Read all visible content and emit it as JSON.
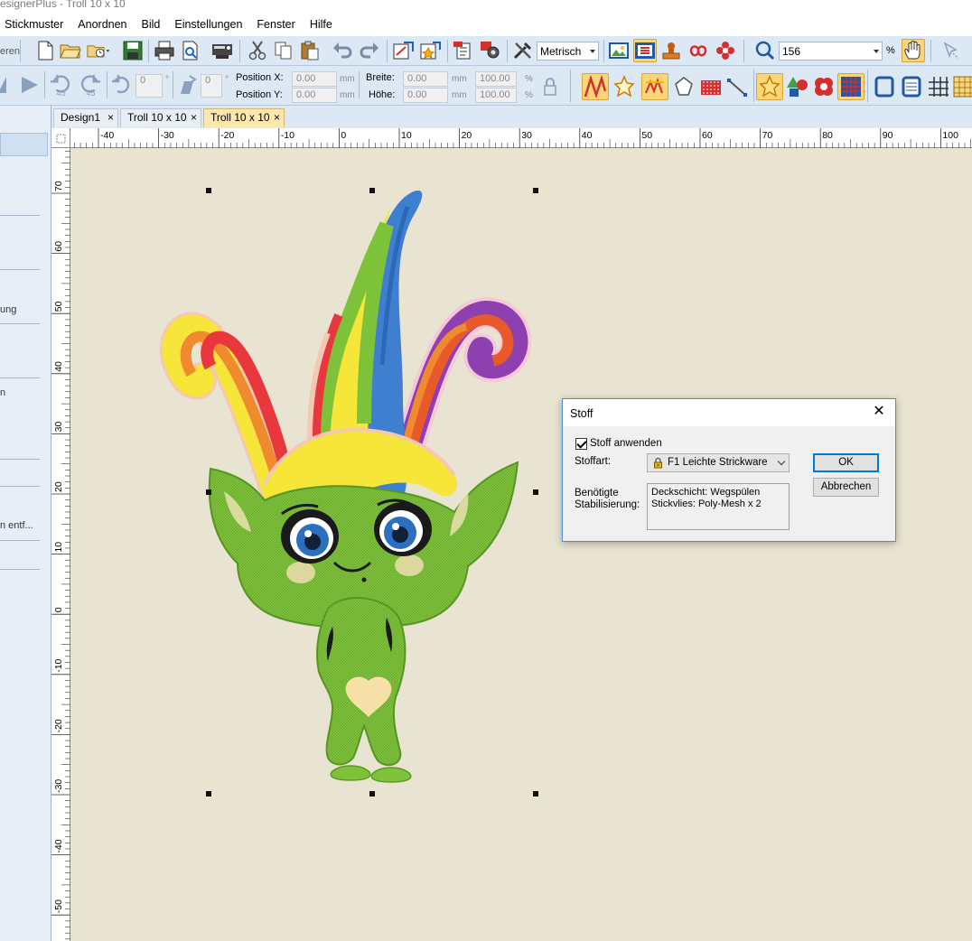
{
  "window": {
    "title": "esignerPlus - Troll 10 x 10"
  },
  "menu": [
    "Stickmuster",
    "Anordnen",
    "Bild",
    "Einstellungen",
    "Fenster",
    "Hilfe"
  ],
  "toolbar1": {
    "left_cut_text": "eren",
    "units_combo": "Metrisch",
    "zoom_value": "156",
    "zoom_unit": "%"
  },
  "toolbar2": {
    "rotate_value": "0",
    "rotate_unit": "°",
    "skew_value": "0",
    "skew_unit": "°",
    "position_x_label": "Position X:",
    "position_y_label": "Position Y:",
    "position_x_value": "0.00",
    "position_y_value": "0.00",
    "width_label": "Breite:",
    "height_label": "Höhe:",
    "width_value": "0.00",
    "height_value": "0.00",
    "unit_mm": "mm",
    "width_pct": "100.00",
    "height_pct": "100.00",
    "pct": "%",
    "rotate_45_left": "45",
    "rotate_45_right": "45"
  },
  "tabs": [
    {
      "label": "Design1",
      "close": "×",
      "active": false
    },
    {
      "label": "Troll 10 x 10",
      "close": "×",
      "active": false
    },
    {
      "label": "Troll 10 x 10",
      "close": "×",
      "active": true
    }
  ],
  "left_panel": {
    "items": [
      "ung",
      "n",
      "n entf..."
    ]
  },
  "ruler_h_labels": [
    "-40",
    "-30",
    "-20",
    "-10",
    "0",
    "10",
    "20",
    "30",
    "40",
    "50",
    "60",
    "70",
    "80",
    "90",
    "100"
  ],
  "ruler_v_labels": [
    "70",
    "60",
    "50",
    "40",
    "30",
    "20",
    "10",
    "0",
    "-10",
    "-20",
    "-30",
    "-40",
    "-50"
  ],
  "dialog": {
    "title": "Stoff",
    "close": "✕",
    "apply_checkbox_label": "Stoff anwenden",
    "apply_checked": true,
    "fabric_label": "Stoffart:",
    "fabric_value": "F1 Leichte Strickware",
    "stabilization_label_1": "Benötigte",
    "stabilization_label_2": "Stabilisierung:",
    "stabilization_line_1": "Deckschicht: Wegspülen",
    "stabilization_line_2": "Stickvlies: Poly-Mesh x 2",
    "ok": "OK",
    "cancel": "Abbrechen"
  },
  "colors": {
    "toolbar_bg": "#dde8f5",
    "canvas_bg": "#e8e4d1",
    "troll_green": "#7ec23a",
    "active_tab": "#fde7b0",
    "dialog_accent": "#0078d7"
  }
}
